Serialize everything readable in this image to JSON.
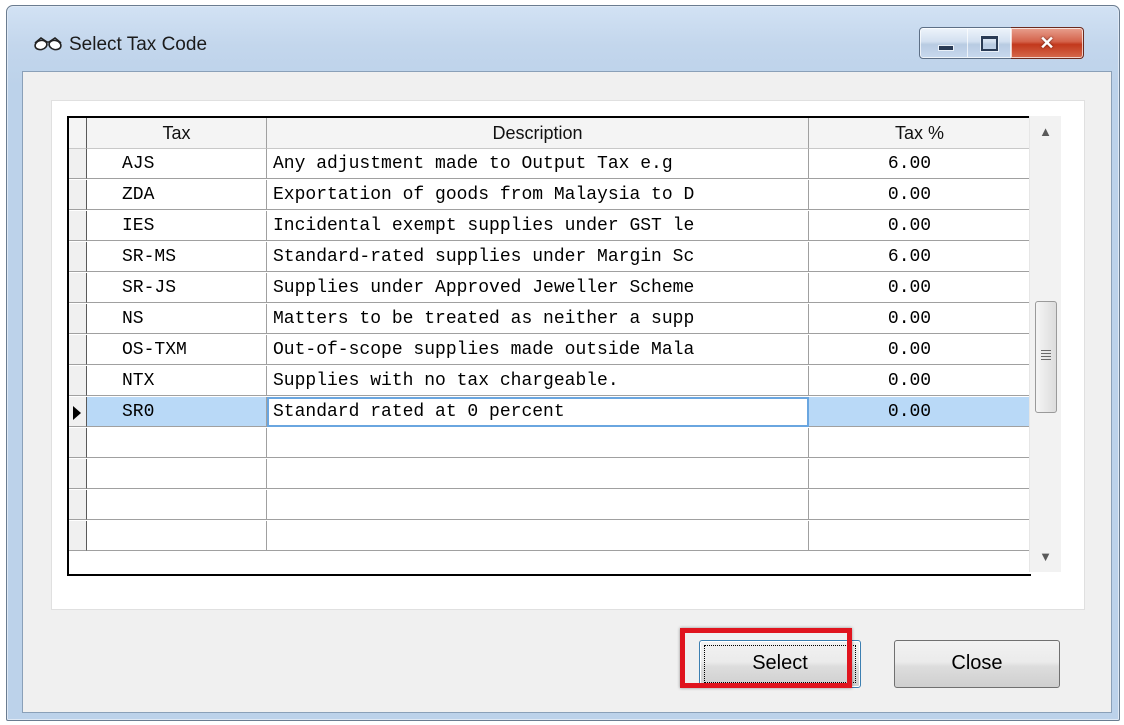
{
  "window": {
    "title": "Select Tax Code"
  },
  "grid": {
    "columns": [
      "Tax",
      "Description",
      "Tax %"
    ],
    "rows": [
      {
        "tax": "AJS",
        "description": "Any adjustment made to Output Tax e.g",
        "pct": "6.00"
      },
      {
        "tax": "ZDA",
        "description": "Exportation of goods from Malaysia to D",
        "pct": "0.00"
      },
      {
        "tax": "IES",
        "description": "Incidental exempt supplies under GST le",
        "pct": "0.00"
      },
      {
        "tax": "SR-MS",
        "description": "Standard-rated supplies under Margin Sc",
        "pct": "6.00"
      },
      {
        "tax": "SR-JS",
        "description": "Supplies under Approved Jeweller Scheme",
        "pct": "0.00"
      },
      {
        "tax": "NS",
        "description": "Matters to be treated as neither a supp",
        "pct": "0.00"
      },
      {
        "tax": "OS-TXM",
        "description": "Out-of-scope supplies made outside Mala",
        "pct": "0.00"
      },
      {
        "tax": "NTX",
        "description": "Supplies with no tax chargeable.",
        "pct": "0.00"
      },
      {
        "tax": "SR0",
        "description": "Standard rated at 0 percent",
        "pct": "0.00"
      },
      {
        "tax": "",
        "description": "",
        "pct": ""
      },
      {
        "tax": "",
        "description": "",
        "pct": ""
      },
      {
        "tax": "",
        "description": "",
        "pct": ""
      },
      {
        "tax": "",
        "description": "",
        "pct": ""
      }
    ],
    "selected_index": 8
  },
  "buttons": {
    "select": "Select",
    "close": "Close"
  },
  "icons": {
    "title": "glasses-icon",
    "minimize": "minimize-icon",
    "maximize": "maximize-icon",
    "close": "close-icon"
  },
  "colors": {
    "selection": "#b9d9f7",
    "highlight": "#e0141e"
  }
}
